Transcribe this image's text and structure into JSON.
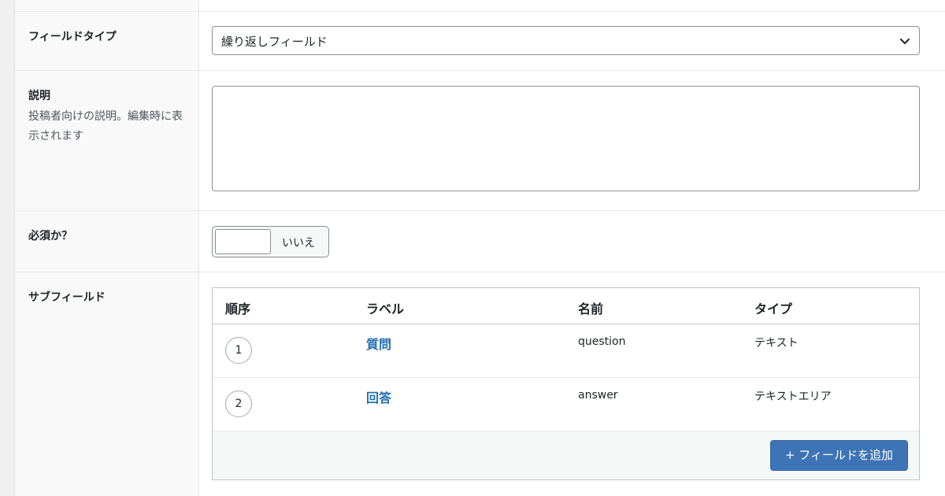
{
  "fields": {
    "field_type": {
      "label": "フィールドタイプ",
      "value": "繰り返しフィールド"
    },
    "description": {
      "label": "説明",
      "help_text": "投稿者向けの説明。編集時に表示されます",
      "value": ""
    },
    "required": {
      "label": "必須か？",
      "toggle_text": "いいえ",
      "checked": false
    },
    "subfields": {
      "label": "サブフィールド",
      "columns": [
        "順序",
        "ラベル",
        "名前",
        "タイプ"
      ],
      "rows": [
        {
          "order": "1",
          "label": "質問",
          "name": "question",
          "type": "テキスト"
        },
        {
          "order": "2",
          "label": "回答",
          "name": "answer",
          "type": "テキストエリア"
        }
      ],
      "add_button": "+ フィールドを追加"
    }
  },
  "colors": {
    "link": "#2271b1",
    "button": "#3d74b5",
    "label_bg": "#f9f9f9"
  },
  "icons": {
    "select": "chevron-down-icon",
    "textarea_resize": "resize-grip-icon"
  }
}
